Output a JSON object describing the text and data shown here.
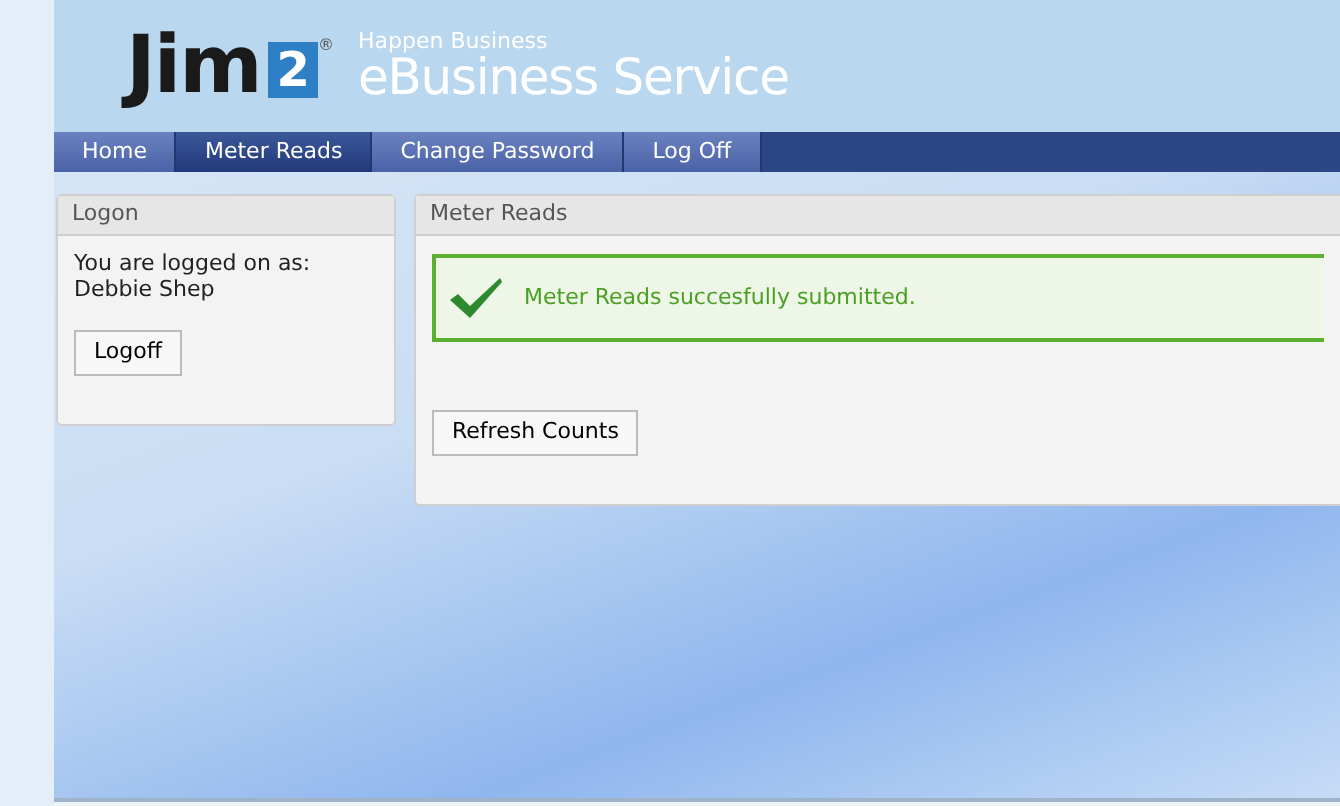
{
  "header": {
    "logo_word": "Jim",
    "logo_number": "2",
    "logo_mark": "®",
    "tagline": "Happen Business",
    "title": "eBusiness Service"
  },
  "nav": [
    {
      "label": "Home",
      "selected": false
    },
    {
      "label": "Meter Reads",
      "selected": true
    },
    {
      "label": "Change Password",
      "selected": false
    },
    {
      "label": "Log Off",
      "selected": false
    }
  ],
  "logon_panel": {
    "title": "Logon",
    "text_lines": [
      "You are logged on as:",
      "Debbie Shep"
    ],
    "button": "Logoff"
  },
  "meter_panel": {
    "title": "Meter Reads",
    "message": "Meter Reads succesfully submitted.",
    "button": "Refresh Counts"
  }
}
